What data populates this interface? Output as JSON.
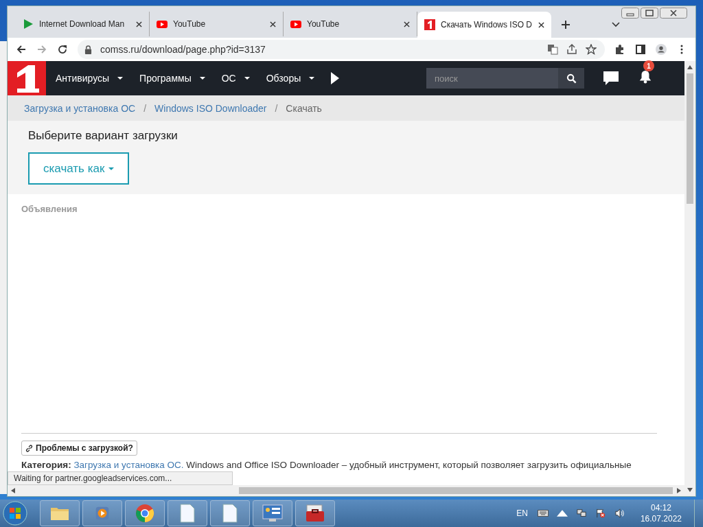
{
  "tabs": [
    {
      "title": "Internet Download Man",
      "kind": "idm",
      "selected": false
    },
    {
      "title": "YouTube",
      "kind": "youtube",
      "selected": false
    },
    {
      "title": "YouTube",
      "kind": "youtube",
      "selected": false
    },
    {
      "title": "Скачать Windows ISO D",
      "kind": "site",
      "selected": true
    }
  ],
  "address": "comss.ru/download/page.php?id=3137",
  "site": {
    "nav": [
      "Антивирусы",
      "Программы",
      "ОС",
      "Обзоры"
    ],
    "search": {
      "placeholder": "поиск"
    },
    "notification_count": "1",
    "breadcrumb_separator": "/",
    "breadcrumb": [
      {
        "label": "Загрузка и установка ОС",
        "current": false
      },
      {
        "label": "Windows ISO Downloader",
        "current": false
      },
      {
        "label": "Скачать",
        "current": true
      }
    ],
    "heading": "Выберите вариант загрузки",
    "download_button": "скачать как",
    "ads_label": "Объявления",
    "problems_button": "Проблемы с загрузкой?",
    "category_label": "Категория:",
    "category_link": "Загрузка и установка ОС.",
    "description": "Windows and Office ISO Downloader – удобный инструмент, который позволяет загрузить официальные"
  },
  "status": "Waiting for partner.googleadservices.com...",
  "taskbar": {
    "apps": [
      {
        "kind": "folder"
      },
      {
        "kind": "media"
      },
      {
        "kind": "chrome"
      },
      {
        "kind": "document"
      },
      {
        "kind": "document"
      },
      {
        "kind": "panel"
      },
      {
        "kind": "toolbox"
      }
    ],
    "language": "EN",
    "time": "04:12",
    "date": "16.07.2022"
  }
}
